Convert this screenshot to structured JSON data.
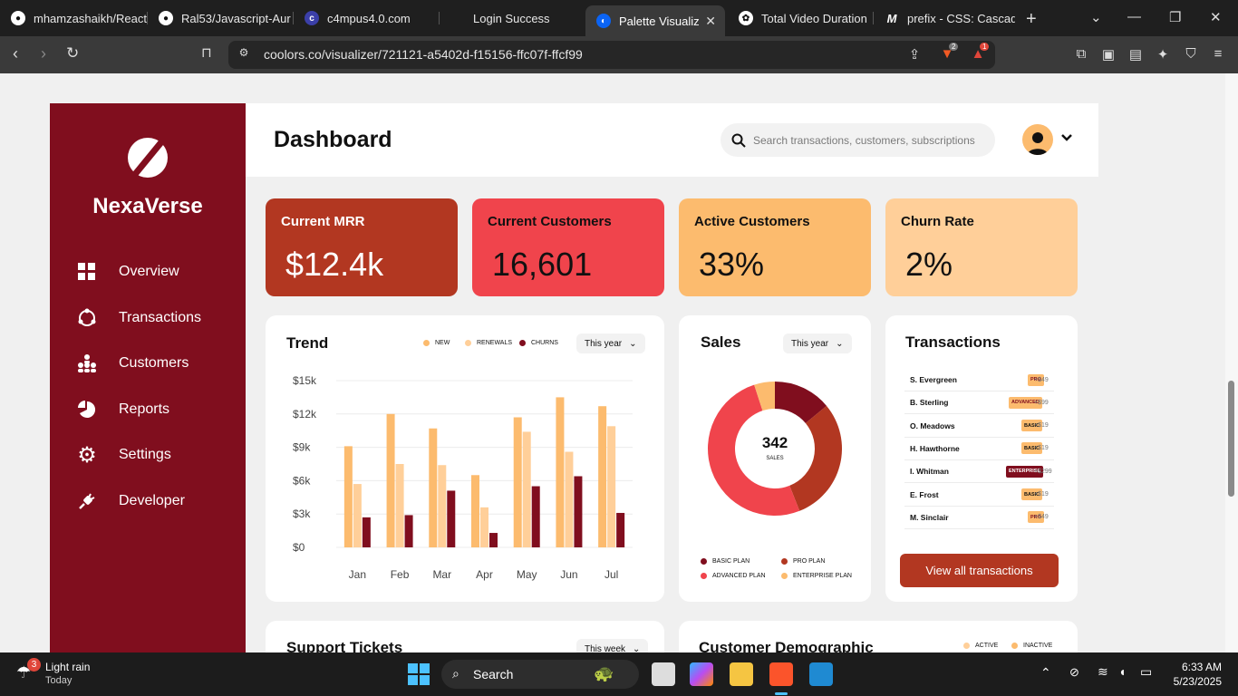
{
  "browser": {
    "tabs": [
      {
        "title": "mhamzashaikh/React",
        "icon": "github-icon"
      },
      {
        "title": "Ral53/Javascript-Aur",
        "icon": "github-icon"
      },
      {
        "title": "c4mpus4.0.com",
        "icon": "site-icon"
      },
      {
        "title": "Login Success",
        "icon": "blank-icon"
      },
      {
        "title": "Palette Visualizer",
        "icon": "coolors-icon",
        "active": true
      },
      {
        "title": "Total Video Duration",
        "icon": "openai-icon"
      },
      {
        "title": "prefix - CSS: Cascadin",
        "icon": "mdn-icon"
      }
    ],
    "url": "coolors.co/visualizer/721121-a5402d-f15156-ffc07f-ffcf99",
    "brave_badge": "2",
    "alert_badge": "1"
  },
  "dashboard": {
    "brand": "NexaVerse",
    "title": "Dashboard",
    "search_placeholder": "Search transactions, customers, subscriptions",
    "nav": [
      {
        "label": "Overview",
        "icon": "grid-icon"
      },
      {
        "label": "Transactions",
        "icon": "cycle-icon"
      },
      {
        "label": "Customers",
        "icon": "people-icon"
      },
      {
        "label": "Reports",
        "icon": "pie-icon"
      },
      {
        "label": "Settings",
        "icon": "gear-icon"
      },
      {
        "label": "Developer",
        "icon": "plug-icon"
      }
    ],
    "kpis": [
      {
        "label": "Current MRR",
        "value": "$12.4k",
        "bg": "#b23721",
        "fg": "#ffffff"
      },
      {
        "label": "Current Customers",
        "value": "16,601",
        "bg": "#f0444c",
        "fg": "#111111"
      },
      {
        "label": "Active Customers",
        "value": "33%",
        "bg": "#fcbb6e",
        "fg": "#111111"
      },
      {
        "label": "Churn Rate",
        "value": "2%",
        "bg": "#ffcf99",
        "fg": "#111111"
      }
    ],
    "trend": {
      "title": "Trend",
      "period": "This year",
      "legend": [
        "NEW",
        "RENEWALS",
        "CHURNS"
      ]
    },
    "sales": {
      "title": "Sales",
      "period": "This year",
      "center_value": "342",
      "center_label": "SALES",
      "legend": [
        "BASIC PLAN",
        "PRO PLAN",
        "ADVANCED PLAN",
        "ENTERPRISE PLAN"
      ]
    },
    "transactions": {
      "title": "Transactions",
      "rows": [
        {
          "name": "S. Evergreen",
          "plan": "PRO",
          "amount": "+$49"
        },
        {
          "name": "B. Sterling",
          "plan": "ADVANCED",
          "amount": "+$99"
        },
        {
          "name": "O. Meadows",
          "plan": "BASIC",
          "amount": "+$19"
        },
        {
          "name": "H. Hawthorne",
          "plan": "BASIC",
          "amount": "+$19"
        },
        {
          "name": "I. Whitman",
          "plan": "ENTERPRISE",
          "amount": "+$299"
        },
        {
          "name": "E. Frost",
          "plan": "BASIC",
          "amount": "+$19"
        },
        {
          "name": "M. Sinclair",
          "plan": "PRO",
          "amount": "+$49"
        }
      ],
      "button": "View all transactions"
    },
    "support": {
      "title": "Support Tickets",
      "period": "This week"
    },
    "demographic": {
      "title": "Customer Demographic",
      "legend": [
        "ACTIVE",
        "INACTIVE"
      ]
    }
  },
  "chart_data": [
    {
      "type": "bar",
      "title": "Trend",
      "categories": [
        "Jan",
        "Feb",
        "Mar",
        "Apr",
        "May",
        "Jun",
        "Jul"
      ],
      "ytick_labels": [
        "$0",
        "$3k",
        "$6k",
        "$9k",
        "$12k",
        "$15k"
      ],
      "ylim": [
        0,
        15000
      ],
      "series": [
        {
          "name": "NEW",
          "color": "#fcbb6e",
          "values": [
            9100,
            12000,
            10700,
            6500,
            11700,
            13500,
            12700
          ]
        },
        {
          "name": "RENEWALS",
          "color": "#ffcf99",
          "values": [
            5700,
            7500,
            7400,
            3600,
            10400,
            8600,
            10900
          ]
        },
        {
          "name": "CHURNS",
          "color": "#800e1e",
          "values": [
            2700,
            2900,
            5100,
            1300,
            5500,
            6400,
            3100
          ]
        }
      ]
    },
    {
      "type": "pie",
      "title": "Sales",
      "categories": [
        "BASIC PLAN",
        "PRO PLAN",
        "ADVANCED PLAN",
        "ENTERPRISE PLAN"
      ],
      "values": [
        14,
        30,
        51,
        5
      ],
      "colors": [
        "#800e1e",
        "#b23721",
        "#f0444c",
        "#fcbb6e"
      ]
    }
  ],
  "taskbar": {
    "weather_badge": "3",
    "weather_title": "Light rain",
    "weather_sub": "Today",
    "search": "Search",
    "time": "6:33 AM",
    "date": "5/23/2025"
  }
}
